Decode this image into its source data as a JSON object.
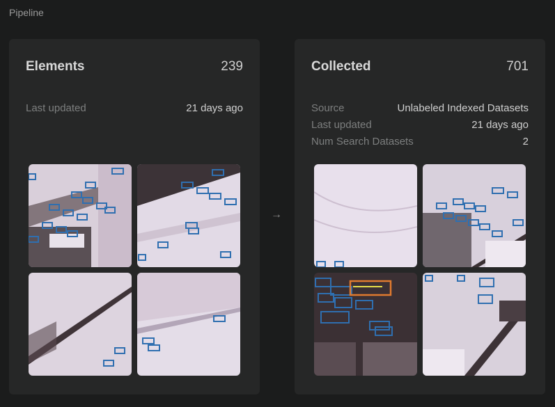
{
  "page": {
    "title": "Pipeline"
  },
  "arrow": {
    "icon": "arrow-right-icon",
    "glyph": "→"
  },
  "cards": [
    {
      "title": "Elements",
      "count": "239",
      "meta": [
        {
          "key": "Last updated",
          "value": "21 days ago"
        }
      ]
    },
    {
      "title": "Collected",
      "count": "701",
      "meta": [
        {
          "key": "Source",
          "value": "Unlabeled Indexed Datasets"
        },
        {
          "key": "Last updated",
          "value": "21 days ago"
        },
        {
          "key": "Num Search Datasets",
          "value": "2"
        }
      ]
    }
  ],
  "colors": {
    "annotation_box": "#2f6fb0",
    "highlight_box": "#e07a2f",
    "background": "#1b1c1c",
    "card": "#262727"
  }
}
